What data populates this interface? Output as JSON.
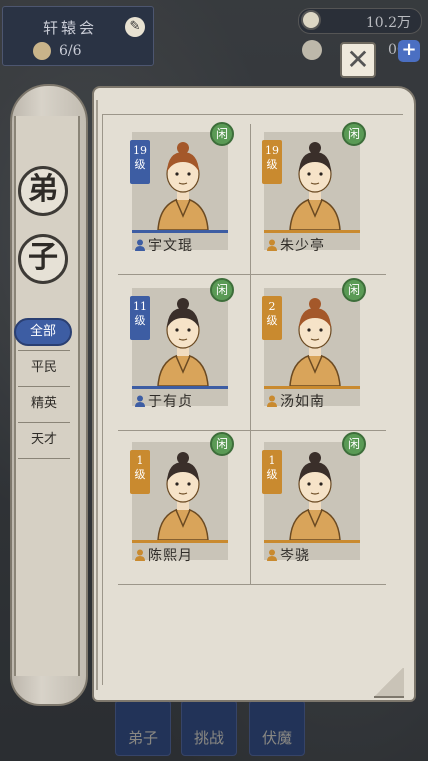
{
  "header": {
    "sect_name": "轩辕会",
    "member_count": "6/6",
    "currency_value": "10.2万",
    "second_currency_value": "00",
    "plus_label": "+",
    "close_label": "✕"
  },
  "book_tabs": {
    "title_char_1": "弟",
    "title_char_2": "子",
    "filters": [
      "全部",
      "平民",
      "精英",
      "天才"
    ],
    "active_filter": "全部"
  },
  "disciples": [
    {
      "name": "宇文琨",
      "level": "19",
      "level_unit": "级",
      "tier": "blue",
      "status": "闲",
      "hair": "brown"
    },
    {
      "name": "朱少亭",
      "level": "19",
      "level_unit": "级",
      "tier": "orange",
      "status": "闲",
      "hair": "black"
    },
    {
      "name": "于有贞",
      "level": "11",
      "level_unit": "级",
      "tier": "blue",
      "status": "闲",
      "hair": "black"
    },
    {
      "name": "汤如南",
      "level": "2",
      "level_unit": "级",
      "tier": "orange",
      "status": "闲",
      "hair": "brown"
    },
    {
      "name": "陈熙月",
      "level": "1",
      "level_unit": "级",
      "tier": "orange",
      "status": "闲",
      "hair": "black"
    },
    {
      "name": "岑骁",
      "level": "1",
      "level_unit": "级",
      "tier": "orange",
      "status": "闲",
      "hair": "black"
    }
  ],
  "bottom_nav": [
    "弟子",
    "挑战",
    "伏魔"
  ],
  "colors": {
    "blue_tier": "#3d5da3",
    "orange_tier": "#c98a2f",
    "idle_badge": "#5a9a55"
  }
}
